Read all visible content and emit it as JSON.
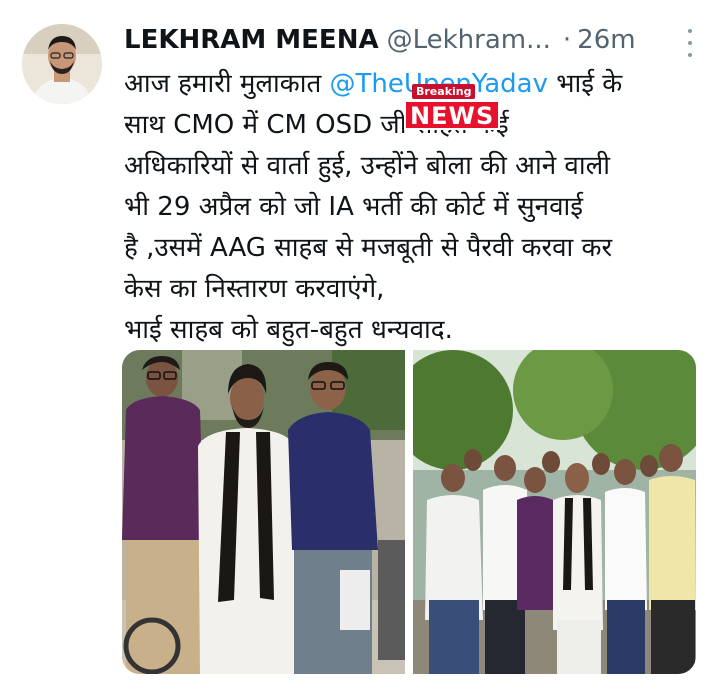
{
  "tweet": {
    "author_name": "LEKHRAM MEENA",
    "handle": "@Lekhram...",
    "separator": "·",
    "timestamp": "26m",
    "text_lines": [
      {
        "before": "आज हमारी मुलाकात ",
        "mention": "@TheUpenYadav",
        "after": " भाई के"
      },
      {
        "text": "साथ CMO में CM OSD जी सहित कई"
      },
      {
        "text": "अधिकारियों से वार्ता हुई, उन्होंने बोला की आने वाली"
      },
      {
        "text": "भी 29 अप्रैल को जो IA  भर्ती की कोर्ट में सुनवाई"
      },
      {
        "text": "है ,उसमें AAG साहब से मजबूती से पैरवी करवा कर"
      },
      {
        "text": "केस का निस्तारण करवाएंगे,"
      },
      {
        "text": "भाई साहब को बहुत-बहुत धन्यवाद."
      }
    ]
  },
  "overlay_badge": {
    "top": "Breaking",
    "main": "NEWS"
  },
  "colors": {
    "mention": "#1d9bf0",
    "muted": "#536471",
    "badge_red": "#e8112d"
  },
  "media": {
    "photos": [
      {
        "name": "meeting-photo-three-men"
      },
      {
        "name": "group-photo-outdoors"
      }
    ]
  }
}
